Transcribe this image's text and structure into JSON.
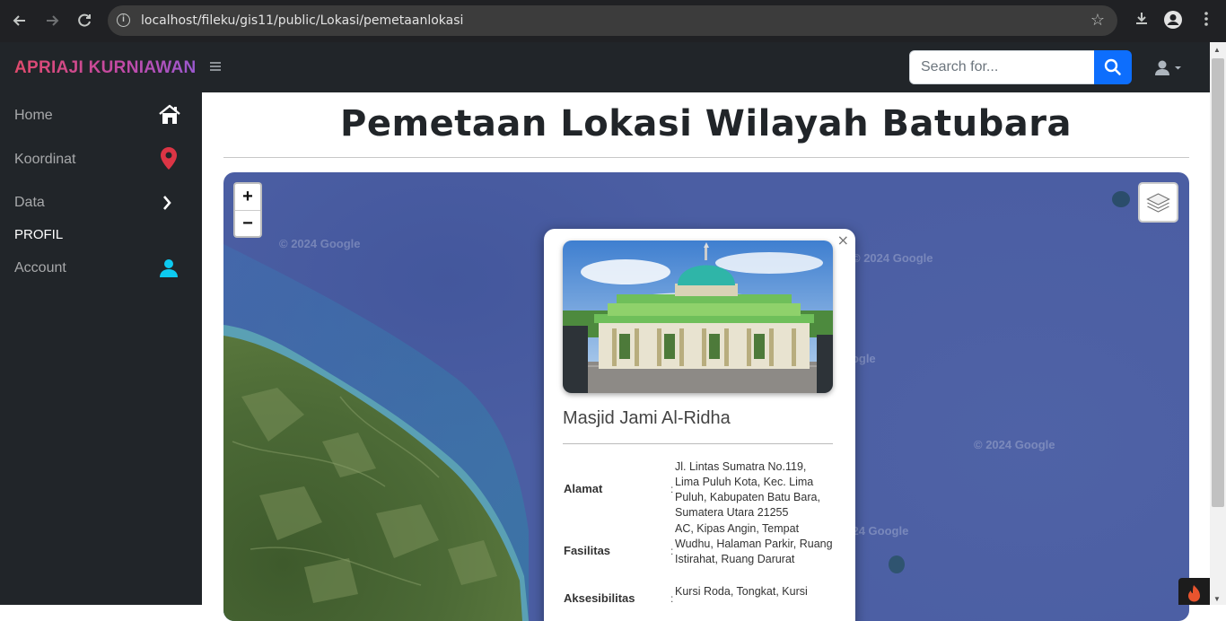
{
  "browser": {
    "url": "localhost/fileku/gis11/public/Lokasi/pemetaanlokasi"
  },
  "topbar": {
    "brand": "APRIAJI KURNIAWAN",
    "search_placeholder": "Search for..."
  },
  "sidebar": {
    "items": [
      {
        "label": "Home",
        "icon": "home-icon"
      },
      {
        "label": "Koordinat",
        "icon": "map-pin-icon"
      },
      {
        "label": "Data",
        "icon": "chevron-right-icon"
      }
    ],
    "heading": "PROFIL",
    "account": {
      "label": "Account",
      "icon": "user-icon"
    }
  },
  "main": {
    "title": "Pemetaan Lokasi Wilayah Batubara"
  },
  "map": {
    "zoom_in": "+",
    "zoom_out": "−",
    "watermark": "© 2024 Google",
    "watermark_partial": "oogle",
    "watermark_partial2": "2024 Google"
  },
  "popup": {
    "close": "×",
    "title": "Masjid Jami Al-Ridha",
    "rows": [
      {
        "label": "Alamat",
        "colon": ":",
        "value": "Jl. Lintas Sumatra No.119, Lima Puluh Kota, Kec. Lima Puluh, Kabupaten Batu Bara, Sumatera Utara 21255"
      },
      {
        "label": "Fasilitas",
        "colon": ":",
        "value": "AC, Kipas Angin, Tempat Wudhu, Halaman Parkir, Ruang Istirahat, Ruang Darurat"
      },
      {
        "label": "Aksesibilitas",
        "colon": ":",
        "value": "Kursi Roda, Tongkat, Kursi"
      }
    ]
  },
  "colors": {
    "sidebar_bg": "#212529",
    "accent_blue": "#0d6efd",
    "pin_red": "#dc3545",
    "user_cyan": "#0dcaf0",
    "sea": "#4b5ea3"
  }
}
